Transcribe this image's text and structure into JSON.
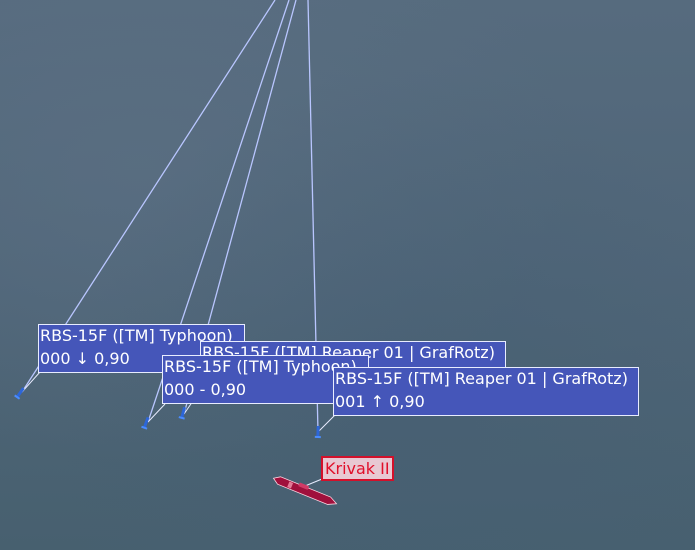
{
  "colors": {
    "sea": "#4f6478",
    "missile_trail": "#b9c6ff",
    "friendly_label_bg": "#4556b9",
    "enemy_label_text": "#e0102a",
    "enemy_ship": "#a0103c"
  },
  "missiles": [
    {
      "name": "RBS-15F ([TM] Typhoon)",
      "status": "000 ↓ 0,90",
      "icon": "missile-icon"
    },
    {
      "name": "RBS-15F ([TM] Reaper 01 | GrafRotz)",
      "status": "",
      "icon": "missile-icon"
    },
    {
      "name": "RBS-15F ([TM] Typhoon)",
      "status": "000 - 0,90",
      "icon": "missile-icon"
    },
    {
      "name": "RBS-15F ([TM] Reaper 01 | GrafRotz)",
      "status": "001 ↑ 0,90",
      "icon": "missile-icon"
    }
  ],
  "target": {
    "name": "Krivak II",
    "icon": "warship-icon"
  }
}
